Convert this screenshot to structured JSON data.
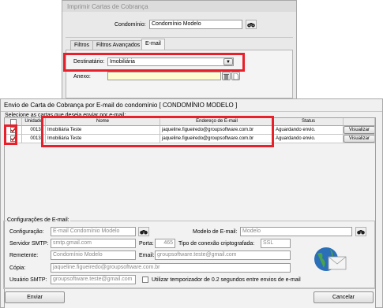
{
  "bg_window": {
    "title": "Imprimir Cartas de Cobrança",
    "condominio_label": "Condomínio:",
    "condominio_value": "Condomínio Modelo",
    "tabs": [
      "Filtros",
      "Filtros Avançados",
      "E-mail"
    ],
    "destinatario_label": "Destinatário:",
    "destinatario_value": "Imobiliária",
    "anexo_label": "Anexo:",
    "anexo_value": ""
  },
  "main": {
    "title": "Envio de Carta de Cobrança por E-mail do condomínio [ CONDOMÍNIO MODELO ]",
    "select_legend": "Selecione as cartas que deseja enviar por e-mail:",
    "columns": [
      "",
      "Unidade",
      "Nome",
      "Endereço de E-mail",
      "Status",
      ""
    ],
    "rows": [
      {
        "unidade": "00133",
        "nome": "Imobiliária Teste",
        "email": "jaqueline.figueiredo@groupsoftware.com.br",
        "status": "Aguardando envio.",
        "action": "Visualizar"
      },
      {
        "unidade": "00133",
        "nome": "Imobiliária Teste",
        "email": "jaqueline.figueiredo@groupsoftware.com.br",
        "status": "Aguardando envio.",
        "action": "Visualizar"
      }
    ]
  },
  "config": {
    "legend": "Configurações de E-mail:",
    "configuracao_label": "Configuração:",
    "configuracao_value": "E-mail Condomínio Modelo",
    "modelo_label": "Modelo de E-mail:",
    "modelo_value": "Modelo",
    "smtp_label": "Servidor SMTP:",
    "smtp_value": "smtp.gmail.com",
    "porta_label": "Porta:",
    "porta_value": "465",
    "conexao_label": "Tipo de conexão criptografada:",
    "conexao_value": "SSL",
    "remetente_label": "Remetente:",
    "remetente_value": "Condomínio Modelo",
    "email_label": "Email:",
    "email_value": "groupsoftware.teste@gmail.com",
    "copia_label": "Cópia:",
    "copia_value": "jaqueline.figueiredo@groupsoftware.com.br",
    "usuario_label": "Usuário SMTP:",
    "usuario_value": "groupsoftware.teste@gmail.com",
    "temporizador_label": "Utilizar temporizador de 0.2 segundos entre envios de e-mail"
  },
  "buttons": {
    "enviar": "Enviar",
    "cancelar": "Cancelar"
  },
  "colors": {
    "highlight": "#e8202b",
    "input_highlight": "#fffccf"
  }
}
